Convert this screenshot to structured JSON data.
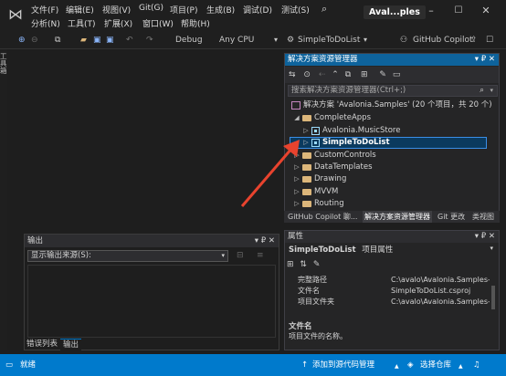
{
  "menu": {
    "row1": [
      "文件(F)",
      "编辑(E)",
      "视图(V)",
      "Git(G)",
      "项目(P)",
      "生成(B)",
      "调试(D)",
      "测试(S)"
    ],
    "row2": [
      "分析(N)",
      "工具(T)",
      "扩展(X)",
      "窗口(W)",
      "帮助(H)"
    ],
    "search_icon": "search-icon"
  },
  "window": {
    "title": "Aval...ples",
    "minimize": "–",
    "maximize": "☐",
    "close": "✕"
  },
  "toolbar": {
    "config": "Debug",
    "platform": "Any CPU",
    "startup": "SimpleToDoList",
    "copilot": "GitHub Copilot"
  },
  "left_tab": "工具箱",
  "output": {
    "title": "输出",
    "source_label": "显示输出来源(S):",
    "pin": "▾ ₽ ✕"
  },
  "bottom_tabs": [
    "错误列表",
    "输出"
  ],
  "solution_explorer": {
    "title": "解决方案资源管理器",
    "search_placeholder": "搜索解决方案资源管理器(Ctrl+;)",
    "items": [
      {
        "label": "解决方案 'Avalonia.Samples' (20 个项目，共 20 个)",
        "kind": "solution",
        "indent": 0,
        "arrow": ""
      },
      {
        "label": "CompleteApps",
        "kind": "folder",
        "indent": 1,
        "arrow": "◢"
      },
      {
        "label": "Avalonia.MusicStore",
        "kind": "project",
        "indent": 2,
        "arrow": "▷"
      },
      {
        "label": "SimpleToDoList",
        "kind": "project",
        "indent": 2,
        "arrow": "▷",
        "selected": true
      },
      {
        "label": "CustomControls",
        "kind": "folder",
        "indent": 1,
        "arrow": "▷"
      },
      {
        "label": "DataTemplates",
        "kind": "folder",
        "indent": 1,
        "arrow": "▷"
      },
      {
        "label": "Drawing",
        "kind": "folder",
        "indent": 1,
        "arrow": "▷"
      },
      {
        "label": "MVVM",
        "kind": "folder",
        "indent": 1,
        "arrow": "▷"
      },
      {
        "label": "Routing",
        "kind": "folder",
        "indent": 1,
        "arrow": "▷"
      }
    ],
    "tabs": [
      "GitHub Copilot 聊...",
      "解决方案资源管理器",
      "Git 更改",
      "类视图"
    ]
  },
  "properties": {
    "title": "属性",
    "object": "SimpleToDoList",
    "object_type": "项目属性",
    "rows": [
      {
        "key": "完整路径",
        "value": "C:\\avalo\\Avalonia.Samples-"
      },
      {
        "key": "文件名",
        "value": "SimpleToDoList.csproj"
      },
      {
        "key": "项目文件夹",
        "value": "C:\\avalo\\Avalonia.Samples-"
      }
    ],
    "desc_title": "文件名",
    "desc_text": "项目文件的名称。"
  },
  "status": {
    "ready": "就绪",
    "source_control": "添加到源代码管理",
    "repo": "选择仓库",
    "bell_icon": "bell-icon"
  },
  "colors": {
    "accent": "#007acc",
    "selection": "#0b3a5e",
    "arrow": "#e8432e"
  }
}
